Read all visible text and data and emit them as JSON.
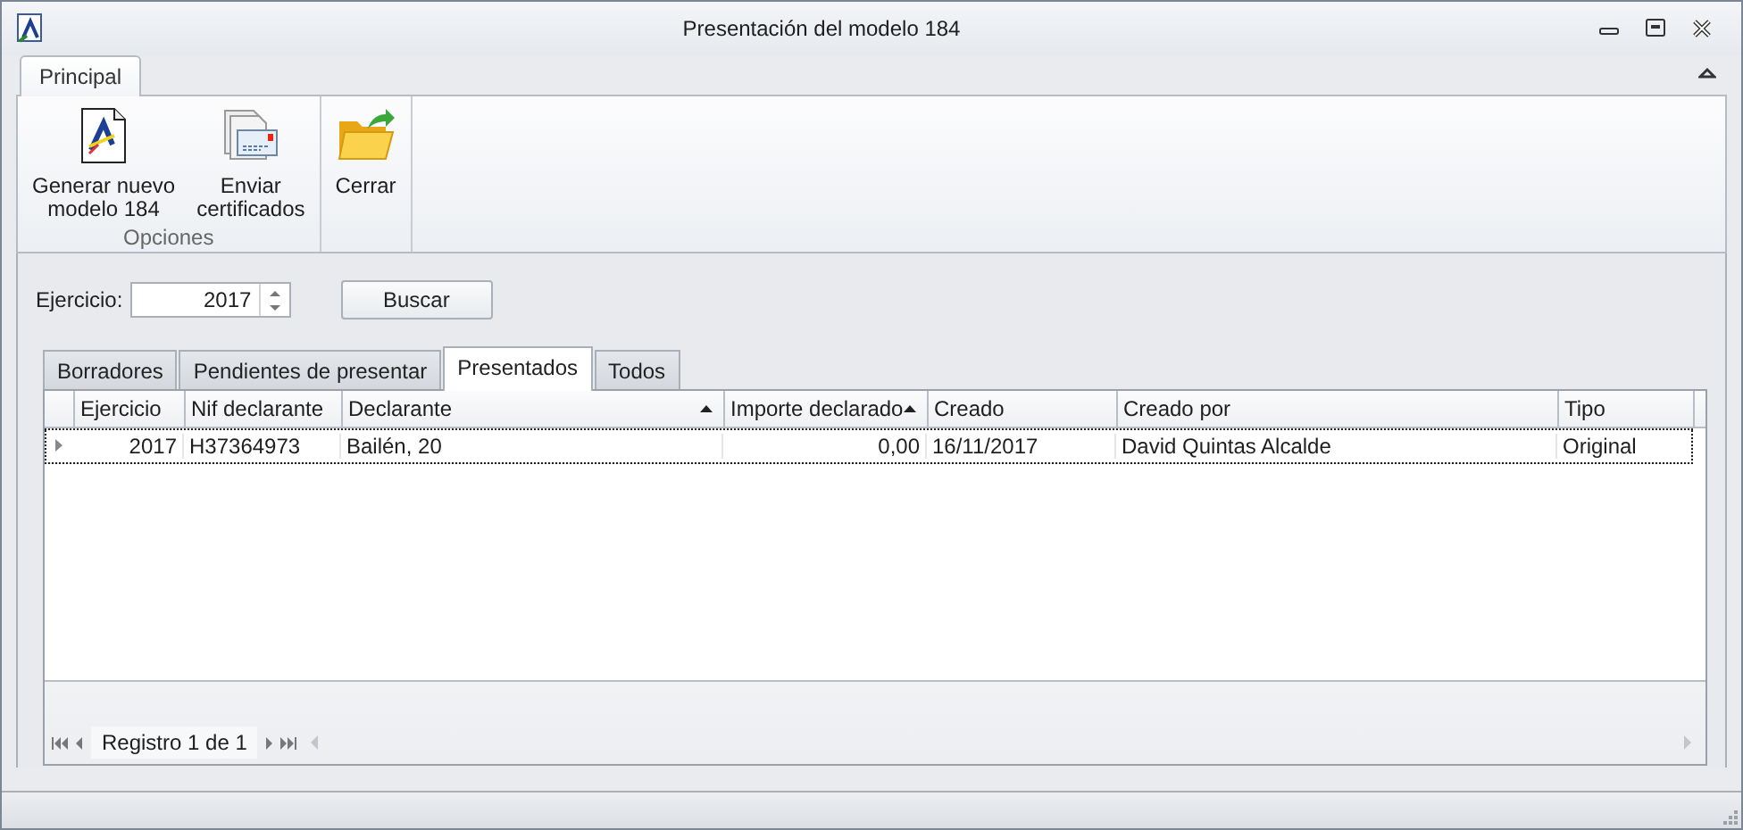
{
  "window": {
    "title": "Presentación del modelo 184"
  },
  "ribbon": {
    "tabs": [
      {
        "label": "Principal",
        "selected": true
      }
    ],
    "groups": [
      {
        "label": "Opciones",
        "buttons": [
          {
            "kind": "document",
            "label": "Generar nuevo\nmodelo 184"
          },
          {
            "kind": "certificates",
            "label": "Enviar\ncertificados"
          }
        ]
      },
      {
        "buttons": [
          {
            "kind": "folder",
            "label": "Cerrar"
          }
        ]
      }
    ]
  },
  "filter": {
    "label": "Ejercicio:",
    "value": "2017",
    "button": "Buscar"
  },
  "tabs": [
    {
      "label": "Borradores",
      "selected": false
    },
    {
      "label": "Pendientes de presentar",
      "selected": false
    },
    {
      "label": "Presentados",
      "selected": true
    },
    {
      "label": "Todos",
      "selected": false
    }
  ],
  "table": {
    "columns": [
      {
        "label": "Ejercicio",
        "sorted": false
      },
      {
        "label": "Nif declarante",
        "sorted": false
      },
      {
        "label": "Declarante",
        "sorted": true
      },
      {
        "label": "Importe declarado",
        "sorted": true
      },
      {
        "label": "Creado",
        "sorted": false
      },
      {
        "label": "Creado por",
        "sorted": false
      },
      {
        "label": "Tipo",
        "sorted": false
      }
    ],
    "rows": [
      {
        "selected": true,
        "cells": [
          "2017",
          "H37364973",
          "Bailén, 20",
          "0,00",
          "16/11/2017",
          "David Quintas Alcalde",
          "Original"
        ]
      }
    ]
  },
  "navigator": {
    "text": "Registro 1 de 1"
  }
}
